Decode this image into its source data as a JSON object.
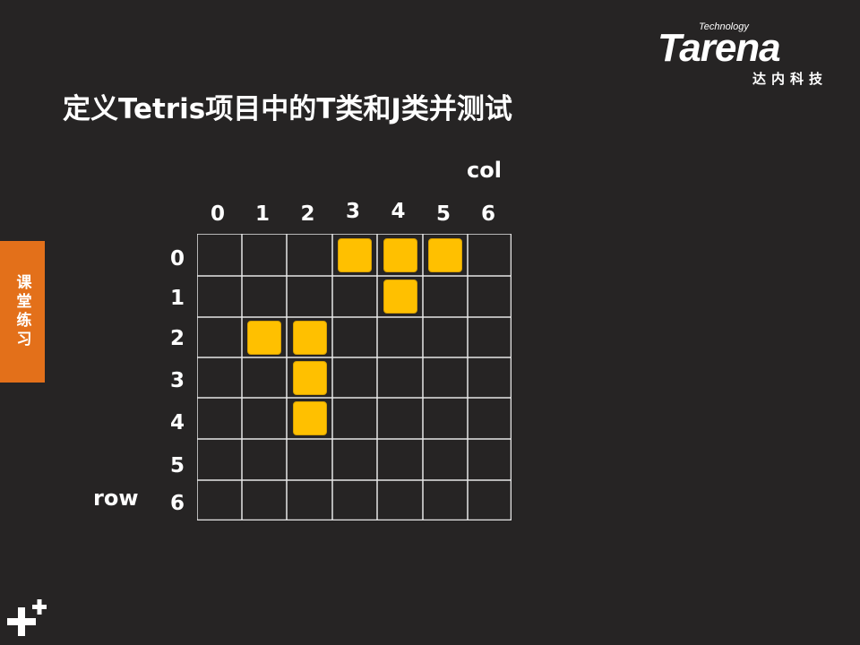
{
  "slide": {
    "title": "定义Tetris项目中的T类和J类并测试",
    "side_tab_label": "课堂练习"
  },
  "brand": {
    "tagline": "Technology",
    "wordmark": "Tarena",
    "chinese_name": "达内科技"
  },
  "grid": {
    "col_axis_label": "col",
    "row_axis_label": "row",
    "col_labels": [
      "0",
      "1",
      "2",
      "3",
      "4",
      "5",
      "6"
    ],
    "row_labels": [
      "0",
      "1",
      "2",
      "3",
      "4",
      "5",
      "6"
    ],
    "rows": 7,
    "cols": 7,
    "filled_cells": [
      {
        "shape": "T",
        "row": 0,
        "col": 3
      },
      {
        "shape": "T",
        "row": 0,
        "col": 4
      },
      {
        "shape": "T",
        "row": 0,
        "col": 5
      },
      {
        "shape": "T",
        "row": 1,
        "col": 4
      },
      {
        "shape": "J",
        "row": 2,
        "col": 1
      },
      {
        "shape": "J",
        "row": 2,
        "col": 2
      },
      {
        "shape": "J",
        "row": 3,
        "col": 2
      },
      {
        "shape": "J",
        "row": 4,
        "col": 2
      }
    ]
  },
  "colors": {
    "background": "#262424",
    "block": "#ffc000",
    "side_tab": "#e3701a",
    "grid_line": "#e6e6e6"
  },
  "icons": {
    "corner": "plus-plus-icon"
  }
}
